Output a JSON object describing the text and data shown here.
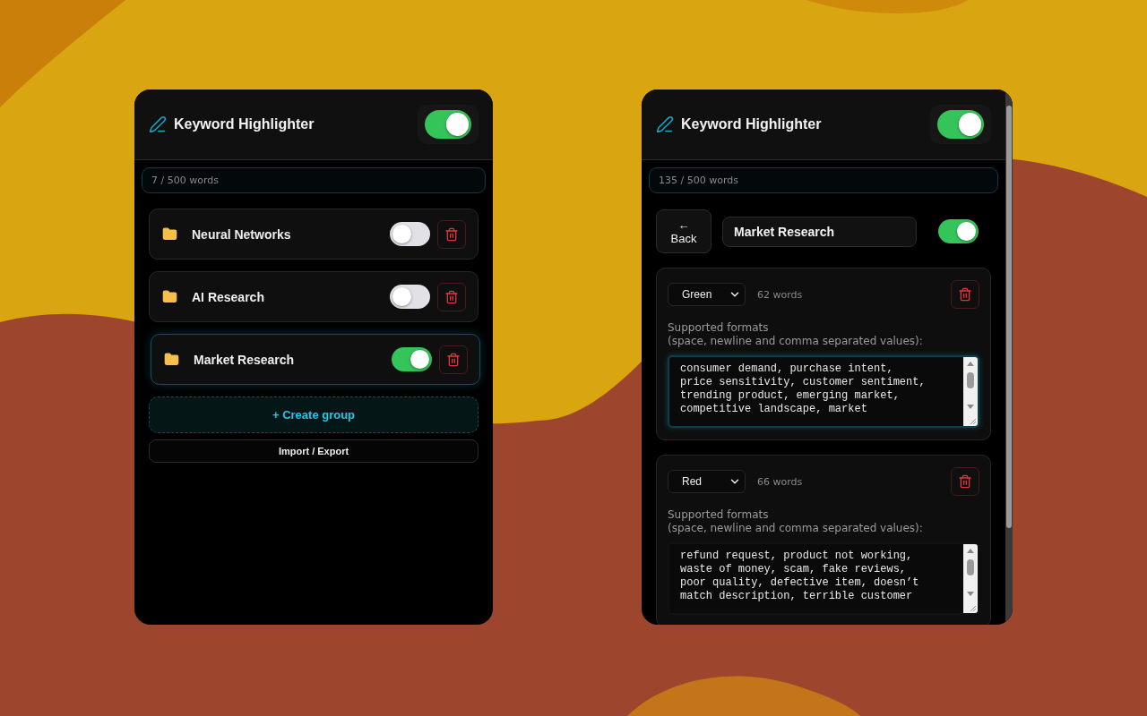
{
  "panels": [
    {
      "kind": "list",
      "title": "Keyword Highlighter",
      "enabled": true,
      "word_count": "7 / 500 words",
      "groups": [
        {
          "name": "Neural Networks",
          "on": false,
          "selected": false
        },
        {
          "name": "AI Research",
          "on": false,
          "selected": false
        },
        {
          "name": "Market Research",
          "on": true,
          "selected": true
        }
      ],
      "create_button": "+ Create group",
      "import_button": "Import / Export"
    },
    {
      "kind": "detail",
      "title": "Keyword Highlighter",
      "enabled": true,
      "word_count": "135 / 500 words",
      "back_arrow": "←",
      "back_label": "Back",
      "group_name": "Market Research",
      "group_on": true,
      "lists": [
        {
          "color_name": "Green",
          "word_count": "62 words",
          "hint": "Supported formats\n(space, newline and comma separated values):",
          "keywords": "consumer demand, purchase intent,\nprice sensitivity, customer sentiment,\ntrending product, emerging market,\ncompetitive landscape, market",
          "focused": true
        },
        {
          "color_name": "Red",
          "word_count": "66 words",
          "hint": "Supported formats\n(space, newline and comma separated values):",
          "keywords": "refund request, product not working,\nwaste of money, scam, fake reviews,\npoor quality, defective item, doesn’t\nmatch description, terrible customer",
          "focused": false
        }
      ]
    }
  ]
}
